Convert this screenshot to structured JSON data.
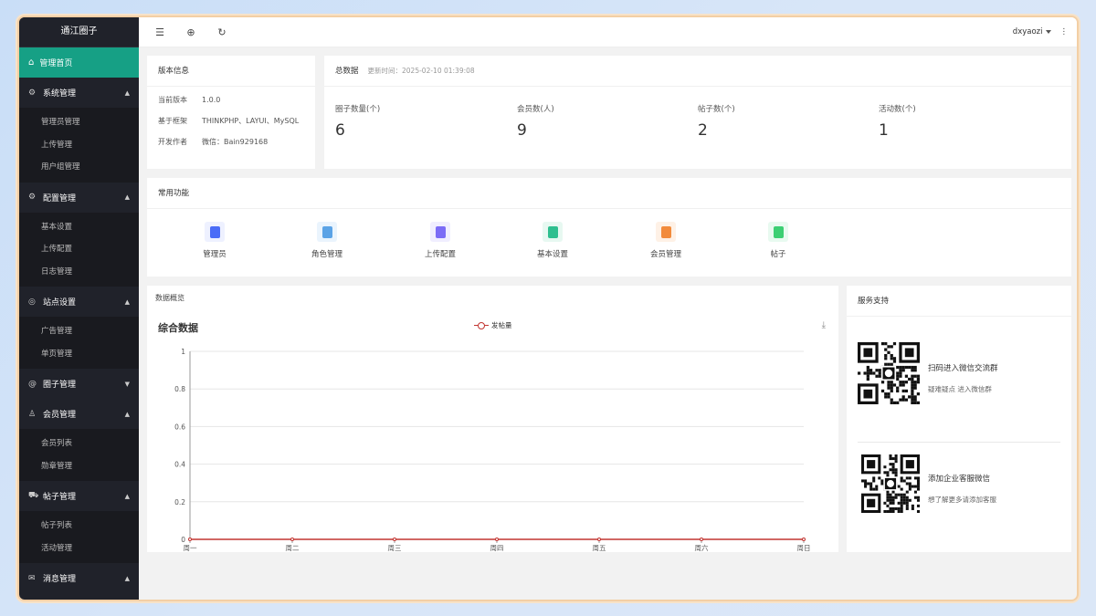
{
  "sidebar": {
    "brand": "通江圈子",
    "home": "管理首页",
    "groups": [
      {
        "label": "系统管理",
        "icon": "gear-icon",
        "items": [
          "管理员管理",
          "上传管理",
          "用户组管理"
        ]
      },
      {
        "label": "配置管理",
        "icon": "settings-icon",
        "items": [
          "基本设置",
          "上传配置",
          "日志管理"
        ]
      },
      {
        "label": "站点设置",
        "icon": "site-icon",
        "items": [
          "广告管理",
          "单页管理"
        ]
      },
      {
        "label": "圈子管理",
        "icon": "at-icon",
        "items": []
      },
      {
        "label": "会员管理",
        "icon": "user-icon",
        "items": [
          "会员列表",
          "勋章管理"
        ]
      },
      {
        "label": "帖子管理",
        "icon": "cart-icon",
        "items": [
          "帖子列表",
          "活动管理"
        ]
      },
      {
        "label": "消息管理",
        "icon": "message-icon",
        "items": []
      }
    ]
  },
  "topbar": {
    "user": "dxyaozi"
  },
  "version": {
    "title": "版本信息",
    "rows": [
      {
        "k": "当前版本",
        "v": "1.0.0"
      },
      {
        "k": "基于框架",
        "v": "THINKPHP、LAYUI、MySQL"
      },
      {
        "k": "开发作者",
        "v": "微信：Bain929168"
      }
    ]
  },
  "totals": {
    "title": "总数据",
    "updated": "更新时间：2025-02-10 01:39:08",
    "stats": [
      {
        "label": "圈子数量(个)",
        "value": "6"
      },
      {
        "label": "会员数(人)",
        "value": "9"
      },
      {
        "label": "帖子数(个)",
        "value": "2"
      },
      {
        "label": "活动数(个)",
        "value": "1"
      }
    ]
  },
  "functions": {
    "title": "常用功能",
    "items": [
      {
        "label": "管理员",
        "color": "#4a6cf7",
        "bg": "#eef1ff"
      },
      {
        "label": "角色管理",
        "color": "#5ba3e6",
        "bg": "#eaf4fd"
      },
      {
        "label": "上传配置",
        "color": "#7b6cf6",
        "bg": "#f0eeff"
      },
      {
        "label": "基本设置",
        "color": "#2fbf8f",
        "bg": "#e7f8f1"
      },
      {
        "label": "会员管理",
        "color": "#f28b3c",
        "bg": "#fef1e6"
      },
      {
        "label": "帖子",
        "color": "#3ccf73",
        "bg": "#e8faf0"
      }
    ]
  },
  "overview": {
    "title": "数据概览",
    "chart_title": "综合数据",
    "legend": "发帖量"
  },
  "service": {
    "title": "服务支持",
    "blocks": [
      {
        "title": "扫码进入微信交流群",
        "sub": "疑难疑点 进入微信群"
      },
      {
        "title": "添加企业客服微信",
        "sub": "想了解更多请添加客服"
      }
    ]
  },
  "chart_data": {
    "type": "line",
    "categories": [
      "周一",
      "周二",
      "周三",
      "周四",
      "周五",
      "周六",
      "周日"
    ],
    "series": [
      {
        "name": "发帖量",
        "values": [
          0,
          0,
          0,
          0,
          0,
          0,
          0
        ]
      }
    ],
    "ylim": [
      0,
      1
    ],
    "yticks": [
      "0",
      "0.2",
      "0.4",
      "0.6",
      "0.8",
      "1"
    ],
    "colors": {
      "series": "#c23531"
    },
    "legend_position": "top-center",
    "grid": true
  }
}
